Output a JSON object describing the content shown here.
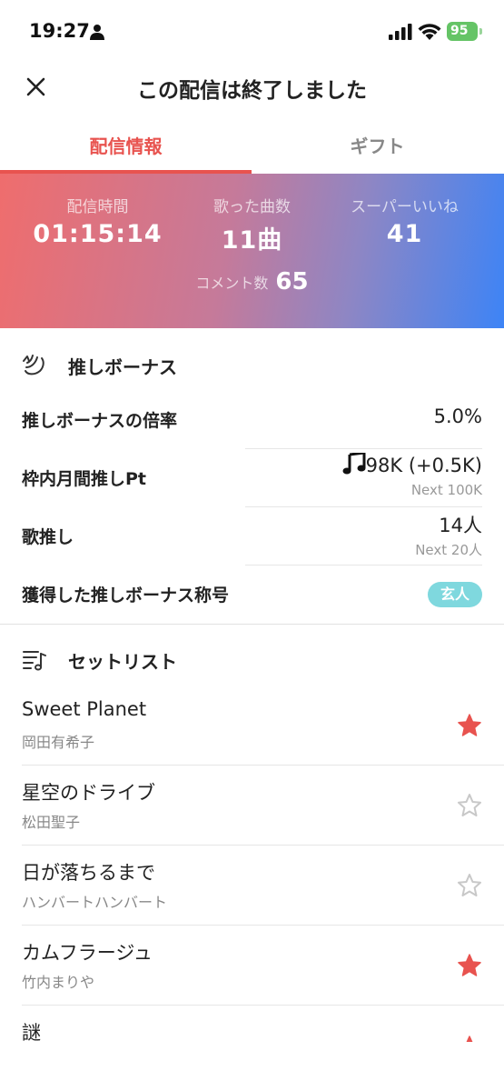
{
  "status_bar": {
    "time": "19:27",
    "battery": "95"
  },
  "header": {
    "title": "この配信は終了しました"
  },
  "tabs": [
    {
      "label": "配信情報",
      "active": true
    },
    {
      "label": "ギフト",
      "active": false
    }
  ],
  "stats": {
    "duration": {
      "label": "配信時間",
      "value": "01:15:14"
    },
    "songs": {
      "label": "歌った曲数",
      "value": "11曲"
    },
    "super_likes": {
      "label": "スーパーいいね",
      "value": "41"
    },
    "comments": {
      "label": "コメント数",
      "value": "65"
    }
  },
  "oshi_bonus": {
    "section_title": "推しボーナス",
    "rate": {
      "label": "推しボーナスの倍率",
      "value": "5.0%"
    },
    "monthly_points": {
      "label": "枠内月間推しPt",
      "value": "98K (+0.5K)",
      "next": "Next 100K"
    },
    "song_oshi": {
      "label": "歌推し",
      "value": "14人",
      "next": "Next 20人"
    },
    "title_earned": {
      "label": "獲得した推しボーナス称号",
      "badge": "玄人"
    }
  },
  "setlist": {
    "section_title": "セットリスト",
    "songs": [
      {
        "title": "Sweet Planet",
        "artist": "岡田有希子",
        "starred": true
      },
      {
        "title": "星空のドライブ",
        "artist": "松田聖子",
        "starred": false
      },
      {
        "title": "日が落ちるまで",
        "artist": "ハンバートハンバート",
        "starred": false
      },
      {
        "title": "カムフラージュ",
        "artist": "竹内まりや",
        "starred": true
      },
      {
        "title": "謎",
        "artist": "",
        "starred": true
      }
    ]
  },
  "colors": {
    "accent": "#e8534f",
    "star_filled": "#e8534f",
    "star_empty": "#c8c8c8",
    "badge": "#7fd8de",
    "gradient_start": "#ef6d6d",
    "gradient_end": "#3d84f6"
  },
  "icons": {
    "close": "close-icon",
    "oshi": "wing-icon",
    "setlist": "music-list-icon",
    "points": "music-note-icon",
    "star": "star-icon"
  }
}
